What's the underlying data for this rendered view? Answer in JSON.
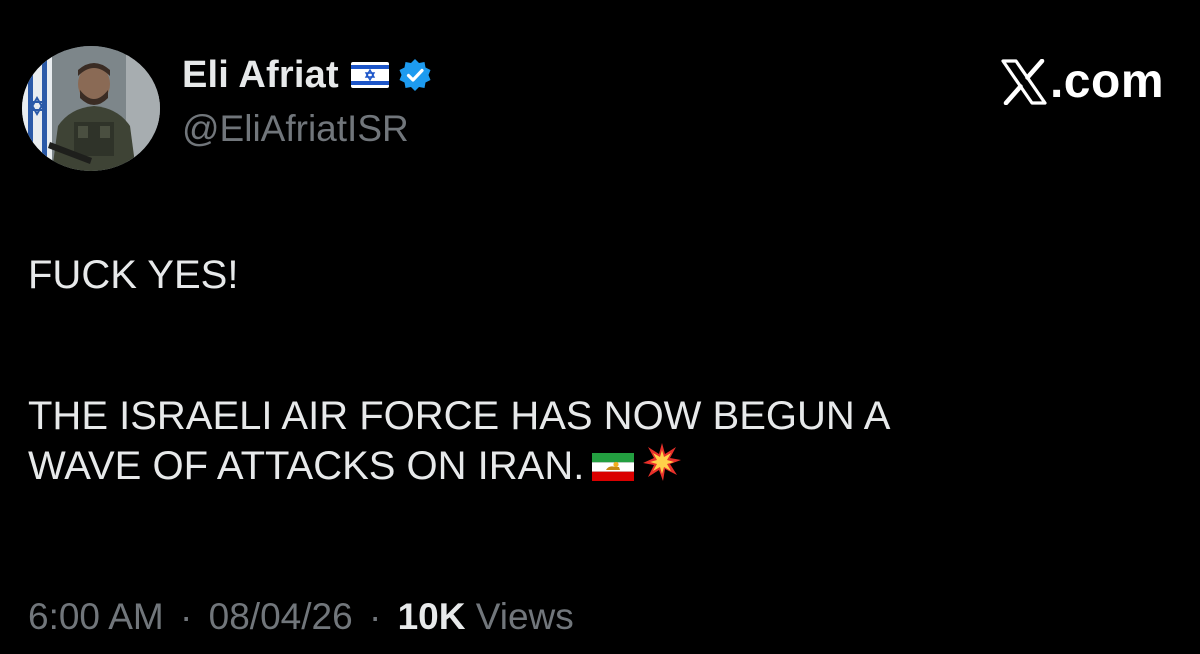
{
  "author": {
    "display_name": "Eli Afriat",
    "handle": "@EliAfriatISR",
    "verified": true,
    "flag_icon": "israel-flag-icon",
    "verified_icon": "verified-badge-icon",
    "avatar_icon": "avatar-photo"
  },
  "site": {
    "label": ".com",
    "logo_icon": "x-logo-icon"
  },
  "tweet": {
    "line1": "FUCK YES!",
    "line2": "THE ISRAELI AIR FORCE HAS NOW BEGUN A",
    "line3": "WAVE OF ATTACKS ON IRAN.",
    "emojis": [
      "iran-lion-sun-flag-icon",
      "collision-icon"
    ]
  },
  "meta": {
    "time": "6:00 AM",
    "separator": "·",
    "date": "08/04/26",
    "views_count": "10K",
    "views_label": "Views"
  },
  "colors": {
    "background": "#000000",
    "text_primary": "#e7e9ea",
    "text_secondary": "#71767b",
    "verified_blue": "#1d9bf0"
  }
}
